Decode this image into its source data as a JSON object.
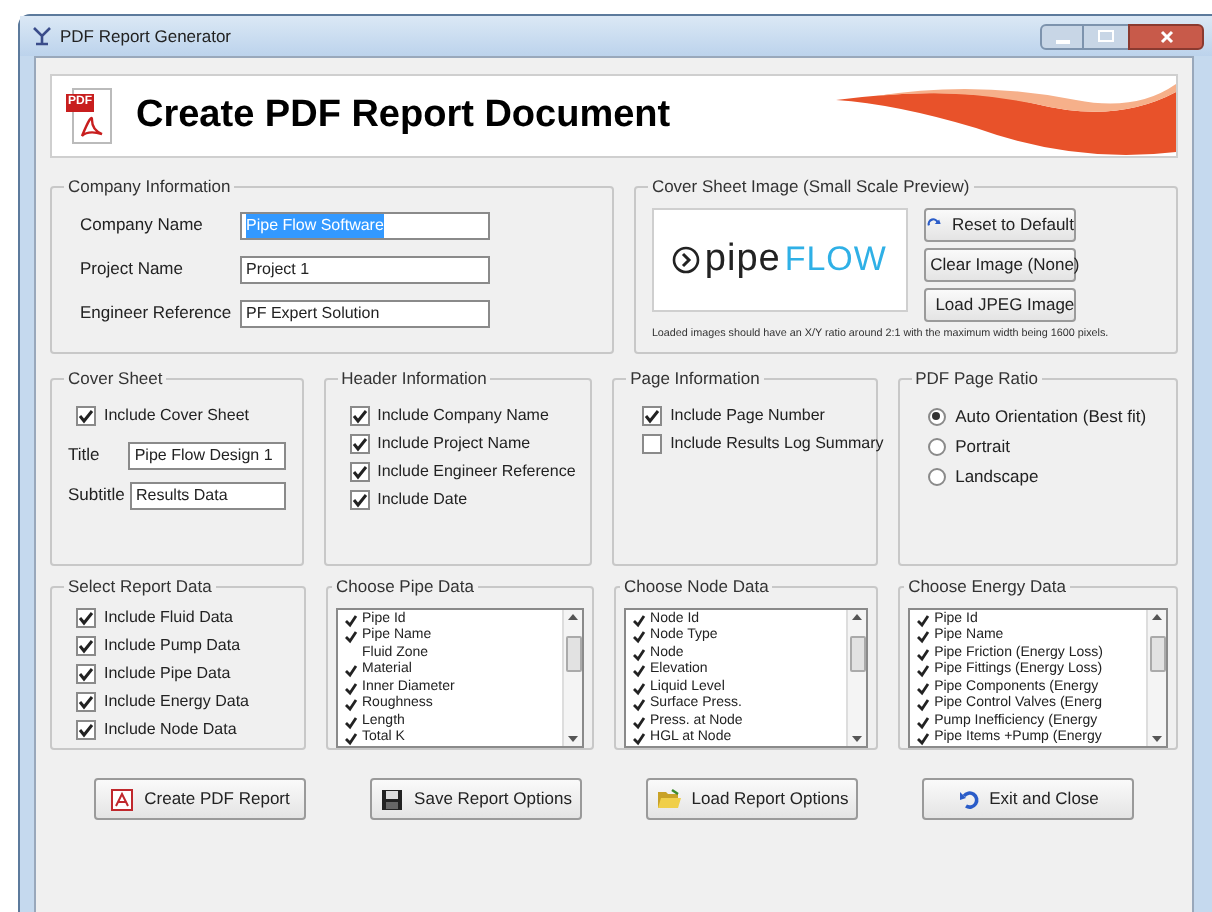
{
  "window": {
    "title": "PDF Report Generator"
  },
  "header": {
    "title": "Create PDF Report Document",
    "icon_label": "PDF"
  },
  "company_information": {
    "title": "Company Information",
    "fields": [
      {
        "label": "Company Name",
        "value": "Pipe Flow Software",
        "highlighted": true
      },
      {
        "label": "Project Name",
        "value": "Project 1",
        "highlighted": false
      },
      {
        "label": "Engineer Reference",
        "value": "PF Expert Solution",
        "highlighted": false
      }
    ]
  },
  "cover_sheet_image": {
    "title": "Cover Sheet Image (Small Scale Preview)",
    "logo_part_1": "pipe",
    "logo_part_2": "FLOW",
    "buttons": [
      {
        "label": "Reset to Default",
        "kind": "reset"
      },
      {
        "label": "Clear Image (None)",
        "kind": "clear"
      },
      {
        "label": "Load JPEG Image",
        "kind": "folder"
      }
    ],
    "note": "Loaded images should have an X/Y ratio around 2:1 with the maximum width being 1600 pixels."
  },
  "cover_sheet": {
    "title": "Cover Sheet",
    "checkbox": {
      "label": "Include Cover Sheet",
      "checked": true
    },
    "fields": [
      {
        "label": "Title",
        "value": "Pipe Flow Design 1"
      },
      {
        "label": "Subtitle",
        "value": "Results Data"
      }
    ]
  },
  "header_information": {
    "title": "Header Information",
    "options": [
      {
        "label": "Include Company Name",
        "checked": true
      },
      {
        "label": "Include Project Name",
        "checked": true
      },
      {
        "label": "Include Engineer Reference",
        "checked": true
      },
      {
        "label": "Include Date",
        "checked": true
      }
    ]
  },
  "page_information": {
    "title": "Page Information",
    "options": [
      {
        "label": "Include Page Number",
        "checked": true
      },
      {
        "label": "Include Results Log Summary",
        "checked": false
      }
    ]
  },
  "pdf_page_ratio": {
    "title": "PDF Page Ratio",
    "options": [
      {
        "label": "Auto Orientation (Best fit)",
        "selected": true
      },
      {
        "label": "Portrait",
        "selected": false
      },
      {
        "label": "Landscape",
        "selected": false
      }
    ]
  },
  "select_report_data": {
    "title": "Select Report Data",
    "options": [
      {
        "label": "Include Fluid Data",
        "checked": true
      },
      {
        "label": "Include Pump Data",
        "checked": true
      },
      {
        "label": "Include Pipe Data",
        "checked": true
      },
      {
        "label": "Include Energy Data",
        "checked": true
      },
      {
        "label": "Include Node Data",
        "checked": true
      }
    ]
  },
  "choose_pipe_data": {
    "title": "Choose Pipe Data",
    "items": [
      {
        "label": "Pipe Id",
        "checked": true
      },
      {
        "label": "Pipe Name",
        "checked": true
      },
      {
        "label": "Fluid Zone",
        "checked": false
      },
      {
        "label": "Material",
        "checked": true
      },
      {
        "label": "Inner Diameter",
        "checked": true
      },
      {
        "label": "Roughness",
        "checked": true
      },
      {
        "label": "Length",
        "checked": true
      },
      {
        "label": "Total K",
        "checked": true
      }
    ]
  },
  "choose_node_data": {
    "title": "Choose Node Data",
    "items": [
      {
        "label": "Node Id",
        "checked": true
      },
      {
        "label": "Node Type",
        "checked": true
      },
      {
        "label": "Node",
        "checked": true
      },
      {
        "label": "Elevation",
        "checked": true
      },
      {
        "label": "Liquid Level",
        "checked": true
      },
      {
        "label": "Surface Press.",
        "checked": true
      },
      {
        "label": "Press. at Node",
        "checked": true
      },
      {
        "label": "HGL at Node",
        "checked": true
      }
    ]
  },
  "choose_energy_data": {
    "title": "Choose Energy Data",
    "items": [
      {
        "label": "Pipe Id",
        "checked": true
      },
      {
        "label": "Pipe Name",
        "checked": true
      },
      {
        "label": "Pipe Friction (Energy Loss)",
        "checked": true
      },
      {
        "label": "Pipe Fittings (Energy Loss)",
        "checked": true
      },
      {
        "label": "Pipe Components (Energy",
        "checked": true
      },
      {
        "label": "Pipe Control Valves (Energ",
        "checked": true
      },
      {
        "label": "Pump Inefficiency (Energy",
        "checked": true
      },
      {
        "label": "Pipe Items +Pump (Energy",
        "checked": true
      }
    ]
  },
  "buttons": [
    {
      "label": "Create PDF Report",
      "kind": "pdf"
    },
    {
      "label": "Save Report Options",
      "kind": "save"
    },
    {
      "label": "Load Report Options",
      "kind": "folder"
    },
    {
      "label": "Exit and Close",
      "kind": "exit"
    }
  ]
}
